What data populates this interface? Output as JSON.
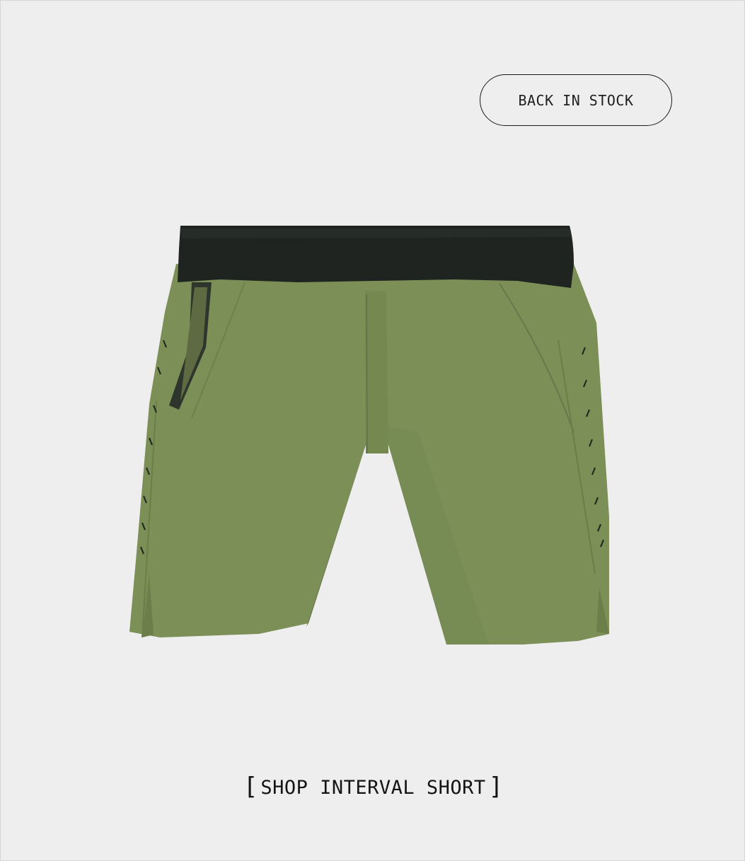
{
  "badge": {
    "label": "BACK IN STOCK"
  },
  "product": {
    "image_alt": "Olive green athletic shorts with black waistband",
    "colors": {
      "fabric": "#7b8f57",
      "fabric_shadow": "#6c7f4a",
      "waistband": "#1f2420",
      "background": "#eeeeee"
    }
  },
  "cta": {
    "open_bracket": "[",
    "label": "SHOP INTERVAL SHORT",
    "close_bracket": "]"
  }
}
